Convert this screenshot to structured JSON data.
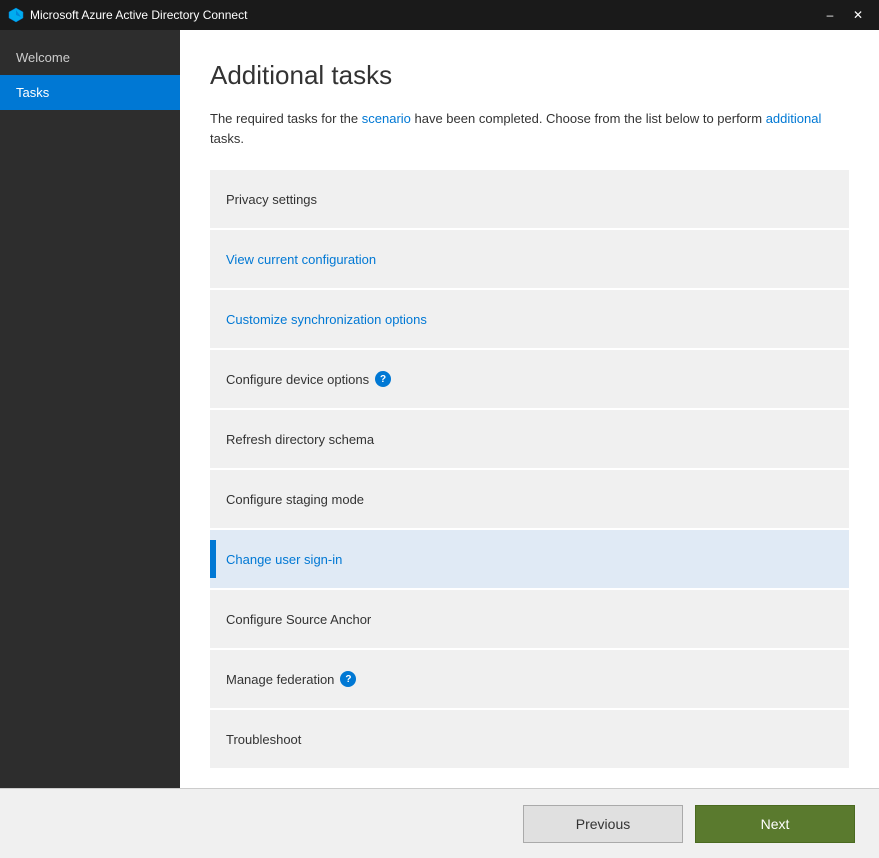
{
  "titleBar": {
    "icon": "azure-ad-icon",
    "title": "Microsoft Azure Active Directory Connect",
    "minimizeLabel": "–",
    "closeLabel": "✕"
  },
  "sidebar": {
    "items": [
      {
        "id": "welcome",
        "label": "Welcome",
        "active": false
      },
      {
        "id": "tasks",
        "label": "Tasks",
        "active": true
      }
    ]
  },
  "main": {
    "pageTitle": "Additional tasks",
    "description": "The required tasks for the scenario have been completed. Choose from the list below to perform additional tasks.",
    "tasks": [
      {
        "id": "privacy-settings",
        "label": "Privacy settings",
        "hasHelp": false,
        "isLink": false,
        "selected": false
      },
      {
        "id": "view-config",
        "label": "View current configuration",
        "hasHelp": false,
        "isLink": true,
        "selected": false
      },
      {
        "id": "customize-sync",
        "label": "Customize synchronization options",
        "hasHelp": false,
        "isLink": true,
        "selected": false
      },
      {
        "id": "configure-device",
        "label": "Configure device options",
        "hasHelp": true,
        "isLink": false,
        "selected": false
      },
      {
        "id": "refresh-schema",
        "label": "Refresh directory schema",
        "hasHelp": false,
        "isLink": false,
        "selected": false
      },
      {
        "id": "staging-mode",
        "label": "Configure staging mode",
        "hasHelp": false,
        "isLink": false,
        "selected": false
      },
      {
        "id": "change-signin",
        "label": "Change user sign-in",
        "hasHelp": false,
        "isLink": false,
        "selected": true
      },
      {
        "id": "source-anchor",
        "label": "Configure Source Anchor",
        "hasHelp": false,
        "isLink": false,
        "selected": false
      },
      {
        "id": "manage-federation",
        "label": "Manage federation",
        "hasHelp": true,
        "isLink": false,
        "selected": false
      },
      {
        "id": "troubleshoot",
        "label": "Troubleshoot",
        "hasHelp": false,
        "isLink": false,
        "selected": false
      }
    ]
  },
  "footer": {
    "previousLabel": "Previous",
    "nextLabel": "Next"
  }
}
